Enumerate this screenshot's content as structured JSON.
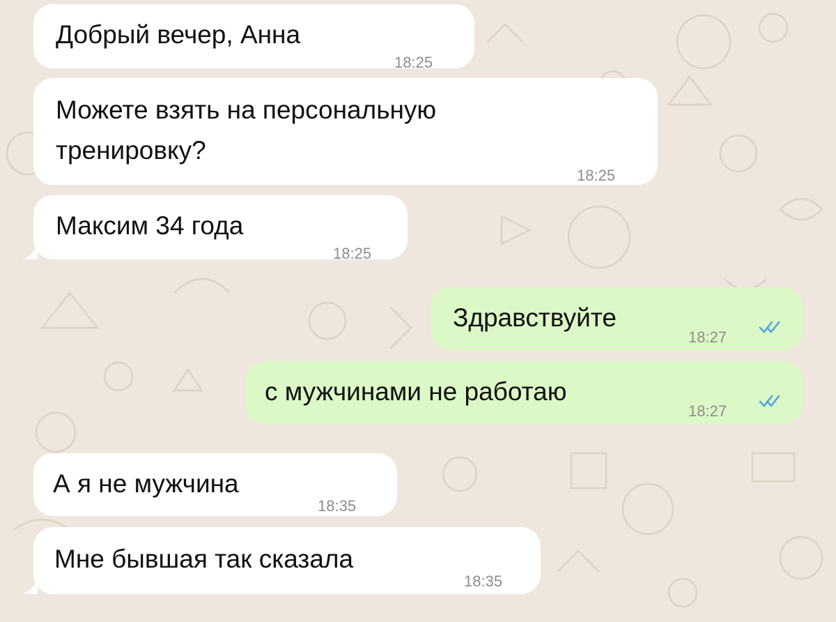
{
  "messages": [
    {
      "direction": "in",
      "lines": [
        "Добрый вечер, Анна"
      ],
      "time": "18:25"
    },
    {
      "direction": "in",
      "lines": [
        "Можете взять на персональную",
        "тренировку?"
      ],
      "time": "18:25"
    },
    {
      "direction": "in",
      "lines": [
        "Максим 34 года"
      ],
      "time": "18:25"
    },
    {
      "direction": "out",
      "lines": [
        "Здравствуйте"
      ],
      "time": "18:27",
      "status": "read"
    },
    {
      "direction": "out",
      "lines": [
        "с мужчинами не работаю"
      ],
      "time": "18:27",
      "status": "read"
    },
    {
      "direction": "in",
      "lines": [
        "А я не мужчина"
      ],
      "time": "18:35"
    },
    {
      "direction": "in",
      "lines": [
        "Мне бывшая так сказала"
      ],
      "time": "18:35"
    }
  ],
  "colors": {
    "background": "#efe7de",
    "incoming_bubble": "#ffffff",
    "outgoing_bubble": "#dcf8c6",
    "read_ticks": "#4fa3e0",
    "timestamp": "#8c8c8c"
  },
  "icons": {
    "read_status": "double-check-icon"
  }
}
